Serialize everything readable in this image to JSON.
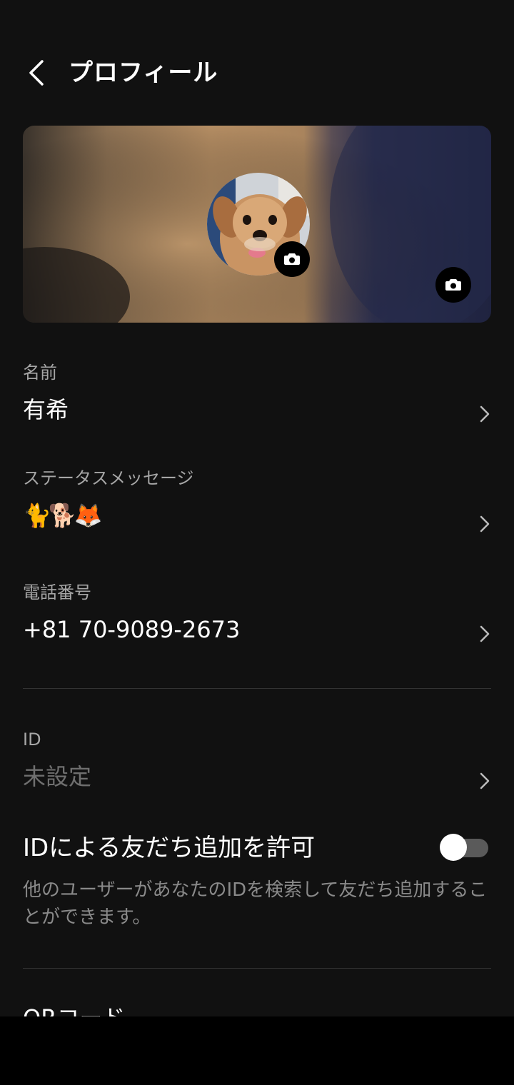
{
  "header": {
    "title": "プロフィール"
  },
  "name_field": {
    "label": "名前",
    "value": "有希"
  },
  "status_field": {
    "label": "ステータスメッセージ",
    "value": "🐈🐕🦊"
  },
  "phone_field": {
    "label": "電話番号",
    "value": "+81 70-9089-2673"
  },
  "id_field": {
    "label": "ID",
    "value": "未設定"
  },
  "id_friend_toggle": {
    "title": "IDによる友だち追加を許可",
    "description": "他のユーザーがあなたのIDを検索して友だち追加することができます。",
    "enabled": false
  },
  "next_section": {
    "label": "QRコード"
  },
  "colors": {
    "background": "#111111",
    "divider": "#333333",
    "secondary_text": "#a6a6a6",
    "muted_text": "#6f6f6f"
  }
}
